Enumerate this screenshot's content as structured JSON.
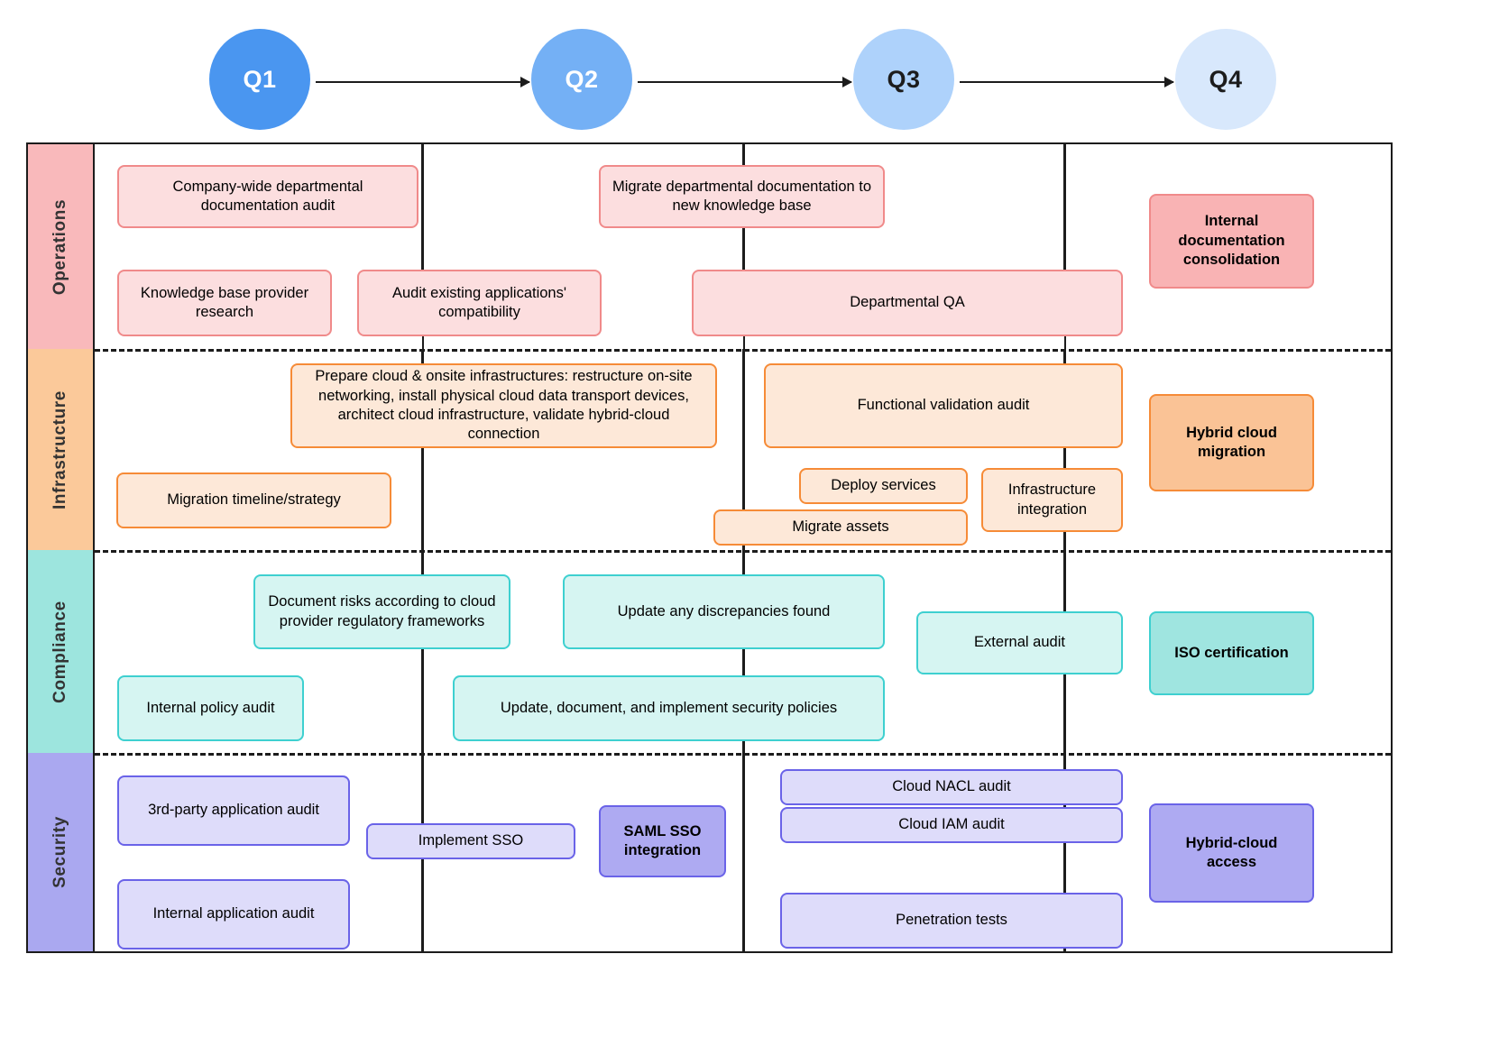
{
  "timeline": {
    "quarters": [
      {
        "label": "Q1",
        "color": "#4a96f0",
        "text_color": "#ffffff"
      },
      {
        "label": "Q2",
        "color": "#74b0f5",
        "text_color": "#ffffff"
      },
      {
        "label": "Q3",
        "color": "#aed2fb",
        "text_color": "#1c1c1c"
      },
      {
        "label": "Q4",
        "color": "#d8e8fc",
        "text_color": "#1c1c1c"
      }
    ]
  },
  "lanes": [
    {
      "name": "Operations",
      "header_color": "#f9b9bb",
      "task_fill": "#fcdedf",
      "task_border": "#f08a8a",
      "milestone_fill": "#f9b3b4",
      "milestone_border": "#f08a8a",
      "tasks": [
        {
          "label": "Company-wide departmental documentation audit",
          "milestone": false
        },
        {
          "label": "Migrate departmental documentation to new knowledge base",
          "milestone": false
        },
        {
          "label": "Knowledge base provider research",
          "milestone": false
        },
        {
          "label": "Audit existing applications' compatibility",
          "milestone": false
        },
        {
          "label": "Departmental QA",
          "milestone": false
        },
        {
          "label": "Internal documentation consolidation",
          "milestone": true
        }
      ]
    },
    {
      "name": "Infrastructure",
      "header_color": "#fbc99a",
      "task_fill": "#fde8d8",
      "task_border": "#f68b37",
      "milestone_fill": "#fac396",
      "milestone_border": "#f68b37",
      "tasks": [
        {
          "label": "Prepare cloud & onsite infrastructures: restructure on-site networking, install physical cloud data transport devices, architect cloud infrastructure, validate hybrid-cloud connection",
          "milestone": false
        },
        {
          "label": "Functional validation audit",
          "milestone": false
        },
        {
          "label": "Migration timeline/strategy",
          "milestone": false
        },
        {
          "label": "Deploy services",
          "milestone": false
        },
        {
          "label": "Migrate assets",
          "milestone": false
        },
        {
          "label": "Infrastructure integration",
          "milestone": false
        },
        {
          "label": "Hybrid cloud migration",
          "milestone": true
        }
      ]
    },
    {
      "name": "Compliance",
      "header_color": "#9de5de",
      "task_fill": "#d6f5f2",
      "task_border": "#3ed0d0",
      "milestone_fill": "#9fe5e0",
      "milestone_border": "#3ed0d0",
      "tasks": [
        {
          "label": "Document risks according to cloud provider regulatory frameworks",
          "milestone": false
        },
        {
          "label": "Update any discrepancies found",
          "milestone": false
        },
        {
          "label": "External audit",
          "milestone": false
        },
        {
          "label": "Internal policy audit",
          "milestone": false
        },
        {
          "label": "Update, document, and implement security policies",
          "milestone": false
        },
        {
          "label": "ISO certification",
          "milestone": true
        }
      ]
    },
    {
      "name": "Security",
      "header_color": "#aaa8f0",
      "task_fill": "#dedcfa",
      "task_border": "#6a63e8",
      "milestone_fill": "#aeaaf2",
      "milestone_border": "#6a63e8",
      "tasks": [
        {
          "label": "3rd-party application audit",
          "milestone": false
        },
        {
          "label": "Internal application audit",
          "milestone": false
        },
        {
          "label": "Implement SSO",
          "milestone": false
        },
        {
          "label": "SAML SSO integration",
          "milestone": true
        },
        {
          "label": "Cloud NACL audit",
          "milestone": false
        },
        {
          "label": "Cloud IAM audit",
          "milestone": false
        },
        {
          "label": "Penetration tests",
          "milestone": false
        },
        {
          "label": "Hybrid-cloud access",
          "milestone": true
        }
      ]
    }
  ]
}
